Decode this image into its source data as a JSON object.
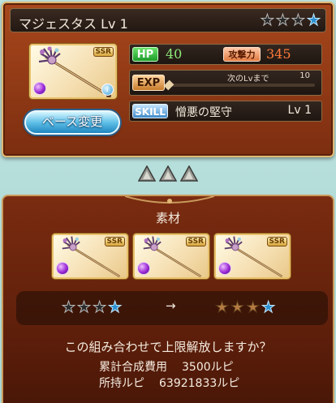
{
  "weapon": {
    "name": "マジェスタス",
    "level_text": "Lv 1",
    "rarity_badge": "SSR",
    "rarity_stars": [
      "empty",
      "empty",
      "empty",
      "blue"
    ]
  },
  "stats": {
    "hp_label": "HP",
    "hp_value": "40",
    "atk_label": "攻撃力",
    "atk_value": "345",
    "exp_label": "EXP",
    "next_level_label": "次のLvまで",
    "next_level_value": "10",
    "exp_progress_fraction": 0,
    "skill_label": "SKILL",
    "skill_name": "憎悪の堅守",
    "skill_level": "Lv 1"
  },
  "buttons": {
    "change_base": "ベース変更"
  },
  "materials": {
    "title": "素材",
    "slots": [
      {
        "badge": "SSR"
      },
      {
        "badge": "SSR"
      },
      {
        "badge": "SSR"
      }
    ]
  },
  "uncap": {
    "before_stars": [
      "empty",
      "empty",
      "empty",
      "blue"
    ],
    "arrow": "→",
    "after_stars": [
      "bronze",
      "bronze",
      "bronze",
      "blue"
    ]
  },
  "confirm": {
    "question": "この組み合わせで上限解放しますか？",
    "cost_label": "累計合成費用",
    "cost_value": "3500ルピ",
    "owned_label": "所持ルピ",
    "owned_value": "63921833ルピ"
  },
  "colors": {
    "panel_primary": "#a8471c",
    "panel_border": "#e0b774",
    "button_blue": "#5fc0e8",
    "hp_green": "#8fe97a",
    "atk_orange": "#ff7a3a"
  }
}
